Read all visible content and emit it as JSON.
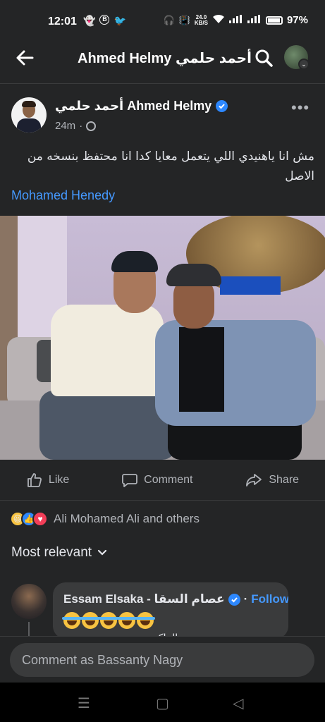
{
  "status_bar": {
    "time": "12:01",
    "notification_icons": [
      "snapchat-icon",
      "b-icon",
      "twitter-icon"
    ],
    "net_speed_value": "24.0",
    "net_speed_unit": "KB/S",
    "battery_percent": "97%"
  },
  "nav": {
    "title": "Ahmed Helmy أحمد حلمي",
    "back_icon": "back-arrow-icon",
    "search_icon": "search-icon"
  },
  "post": {
    "author": "أحمد حلمي Ahmed Helmy",
    "time": "24m",
    "audience_icon": "globe-icon",
    "text": "مش انا ياهنيدي اللي يتعمل معايا كدا انا محتفظ بنسخه من الاصل",
    "mention": "Mohamed Henedy"
  },
  "actions": {
    "like": "Like",
    "comment": "Comment",
    "share": "Share"
  },
  "reactions": {
    "types": [
      "haha",
      "like",
      "love"
    ],
    "summary": "Ali Mohamed Ali and others"
  },
  "comments": {
    "sort_label": "Most relevant",
    "first": {
      "author": "Essam Elsaka - عصام السقا",
      "separator": "·",
      "follow": "Follow",
      "emoji_count": 5,
      "partial_text": "...ة الماكية"
    }
  },
  "composer": {
    "placeholder": "Comment as Bassanty Nagy"
  },
  "colors": {
    "background": "#242526",
    "surface": "#3a3b3c",
    "link": "#4599ff",
    "verified": "#2d88ff",
    "text_primary": "#e4e6eb",
    "text_secondary": "#b0b3b8"
  }
}
